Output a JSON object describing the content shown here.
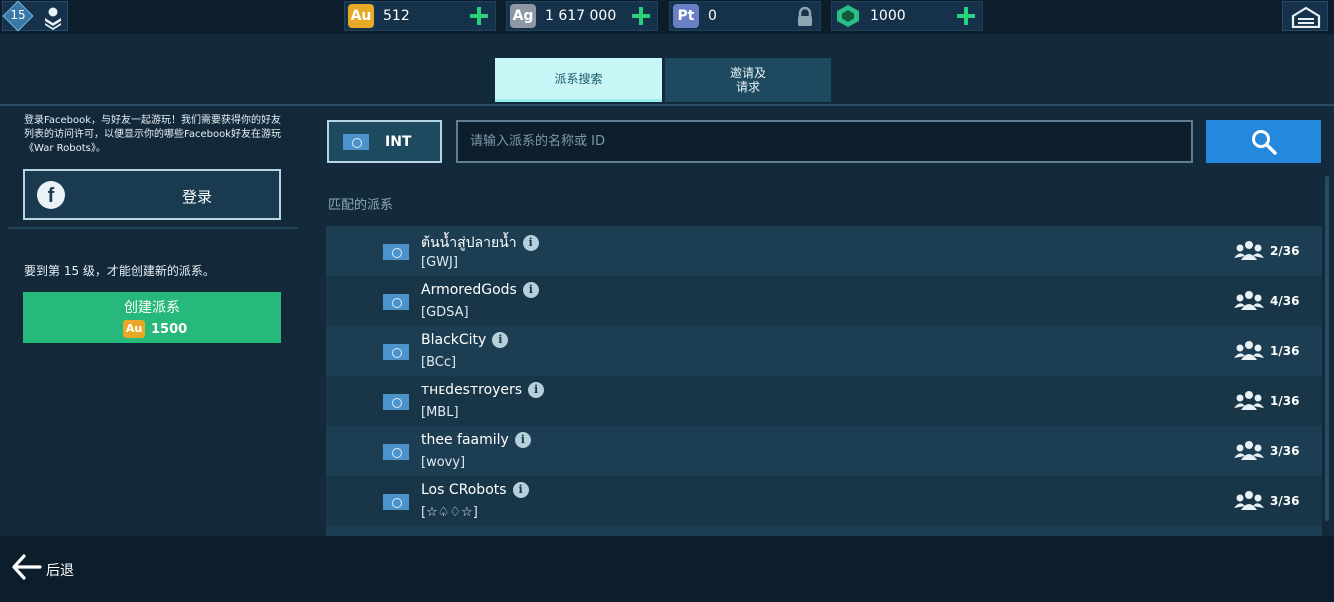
{
  "topbar": {
    "level": "15",
    "resources": [
      {
        "badge": "Au",
        "value": "512",
        "color": "#e9a825",
        "action": "plus"
      },
      {
        "badge": "Ag",
        "value": "1 617 000",
        "color": "#8d98a3",
        "action": "plus"
      },
      {
        "badge": "Pt",
        "value": "0",
        "color": "#6a7fc4",
        "action": "lock"
      },
      {
        "badge": "",
        "value": "1000",
        "color": "#27c08a",
        "action": "plus"
      }
    ]
  },
  "tabs": [
    {
      "label": "派系搜索",
      "active": true
    },
    {
      "label": "邀请及\n请求",
      "active": false
    }
  ],
  "left": {
    "fb_text": "登录Facebook，与好友一起游玩！我们需要获得你的好友列表的访问许可，以便显示你的哪些Facebook好友在游玩《War Robots》。",
    "fb_login_label": "登录",
    "level_requirement": "要到第 15 级，才能创建新的派系。",
    "create_label": "创建派系",
    "create_cost_badge": "Au",
    "create_cost": "1500"
  },
  "search": {
    "region": "INT",
    "placeholder": "请输入派系的名称或 ID"
  },
  "list_title": "匹配的派系",
  "clans": [
    {
      "name": "ต้นน้ำสู่ปลายน้ำ",
      "tag": "[GWJ]",
      "members": "2/36"
    },
    {
      "name": "ArmoredGods",
      "tag": "[GDSA]",
      "members": "4/36"
    },
    {
      "name": "BlackCity",
      "tag": "[BCc]",
      "members": "1/36"
    },
    {
      "name": "ᴛʜᴇdesᴛroyers",
      "tag": "[MBL]",
      "members": "1/36"
    },
    {
      "name": "thee faamily",
      "tag": "[wovy]",
      "members": "3/36"
    },
    {
      "name": "Los CRobots",
      "tag": "[☆♤♢☆]",
      "members": "3/36"
    }
  ],
  "bottom": {
    "back_label": "后退"
  },
  "colors": {
    "accent_green": "#27b87c",
    "search_blue": "#2489dc",
    "tab_active": "#c8f6f6"
  }
}
